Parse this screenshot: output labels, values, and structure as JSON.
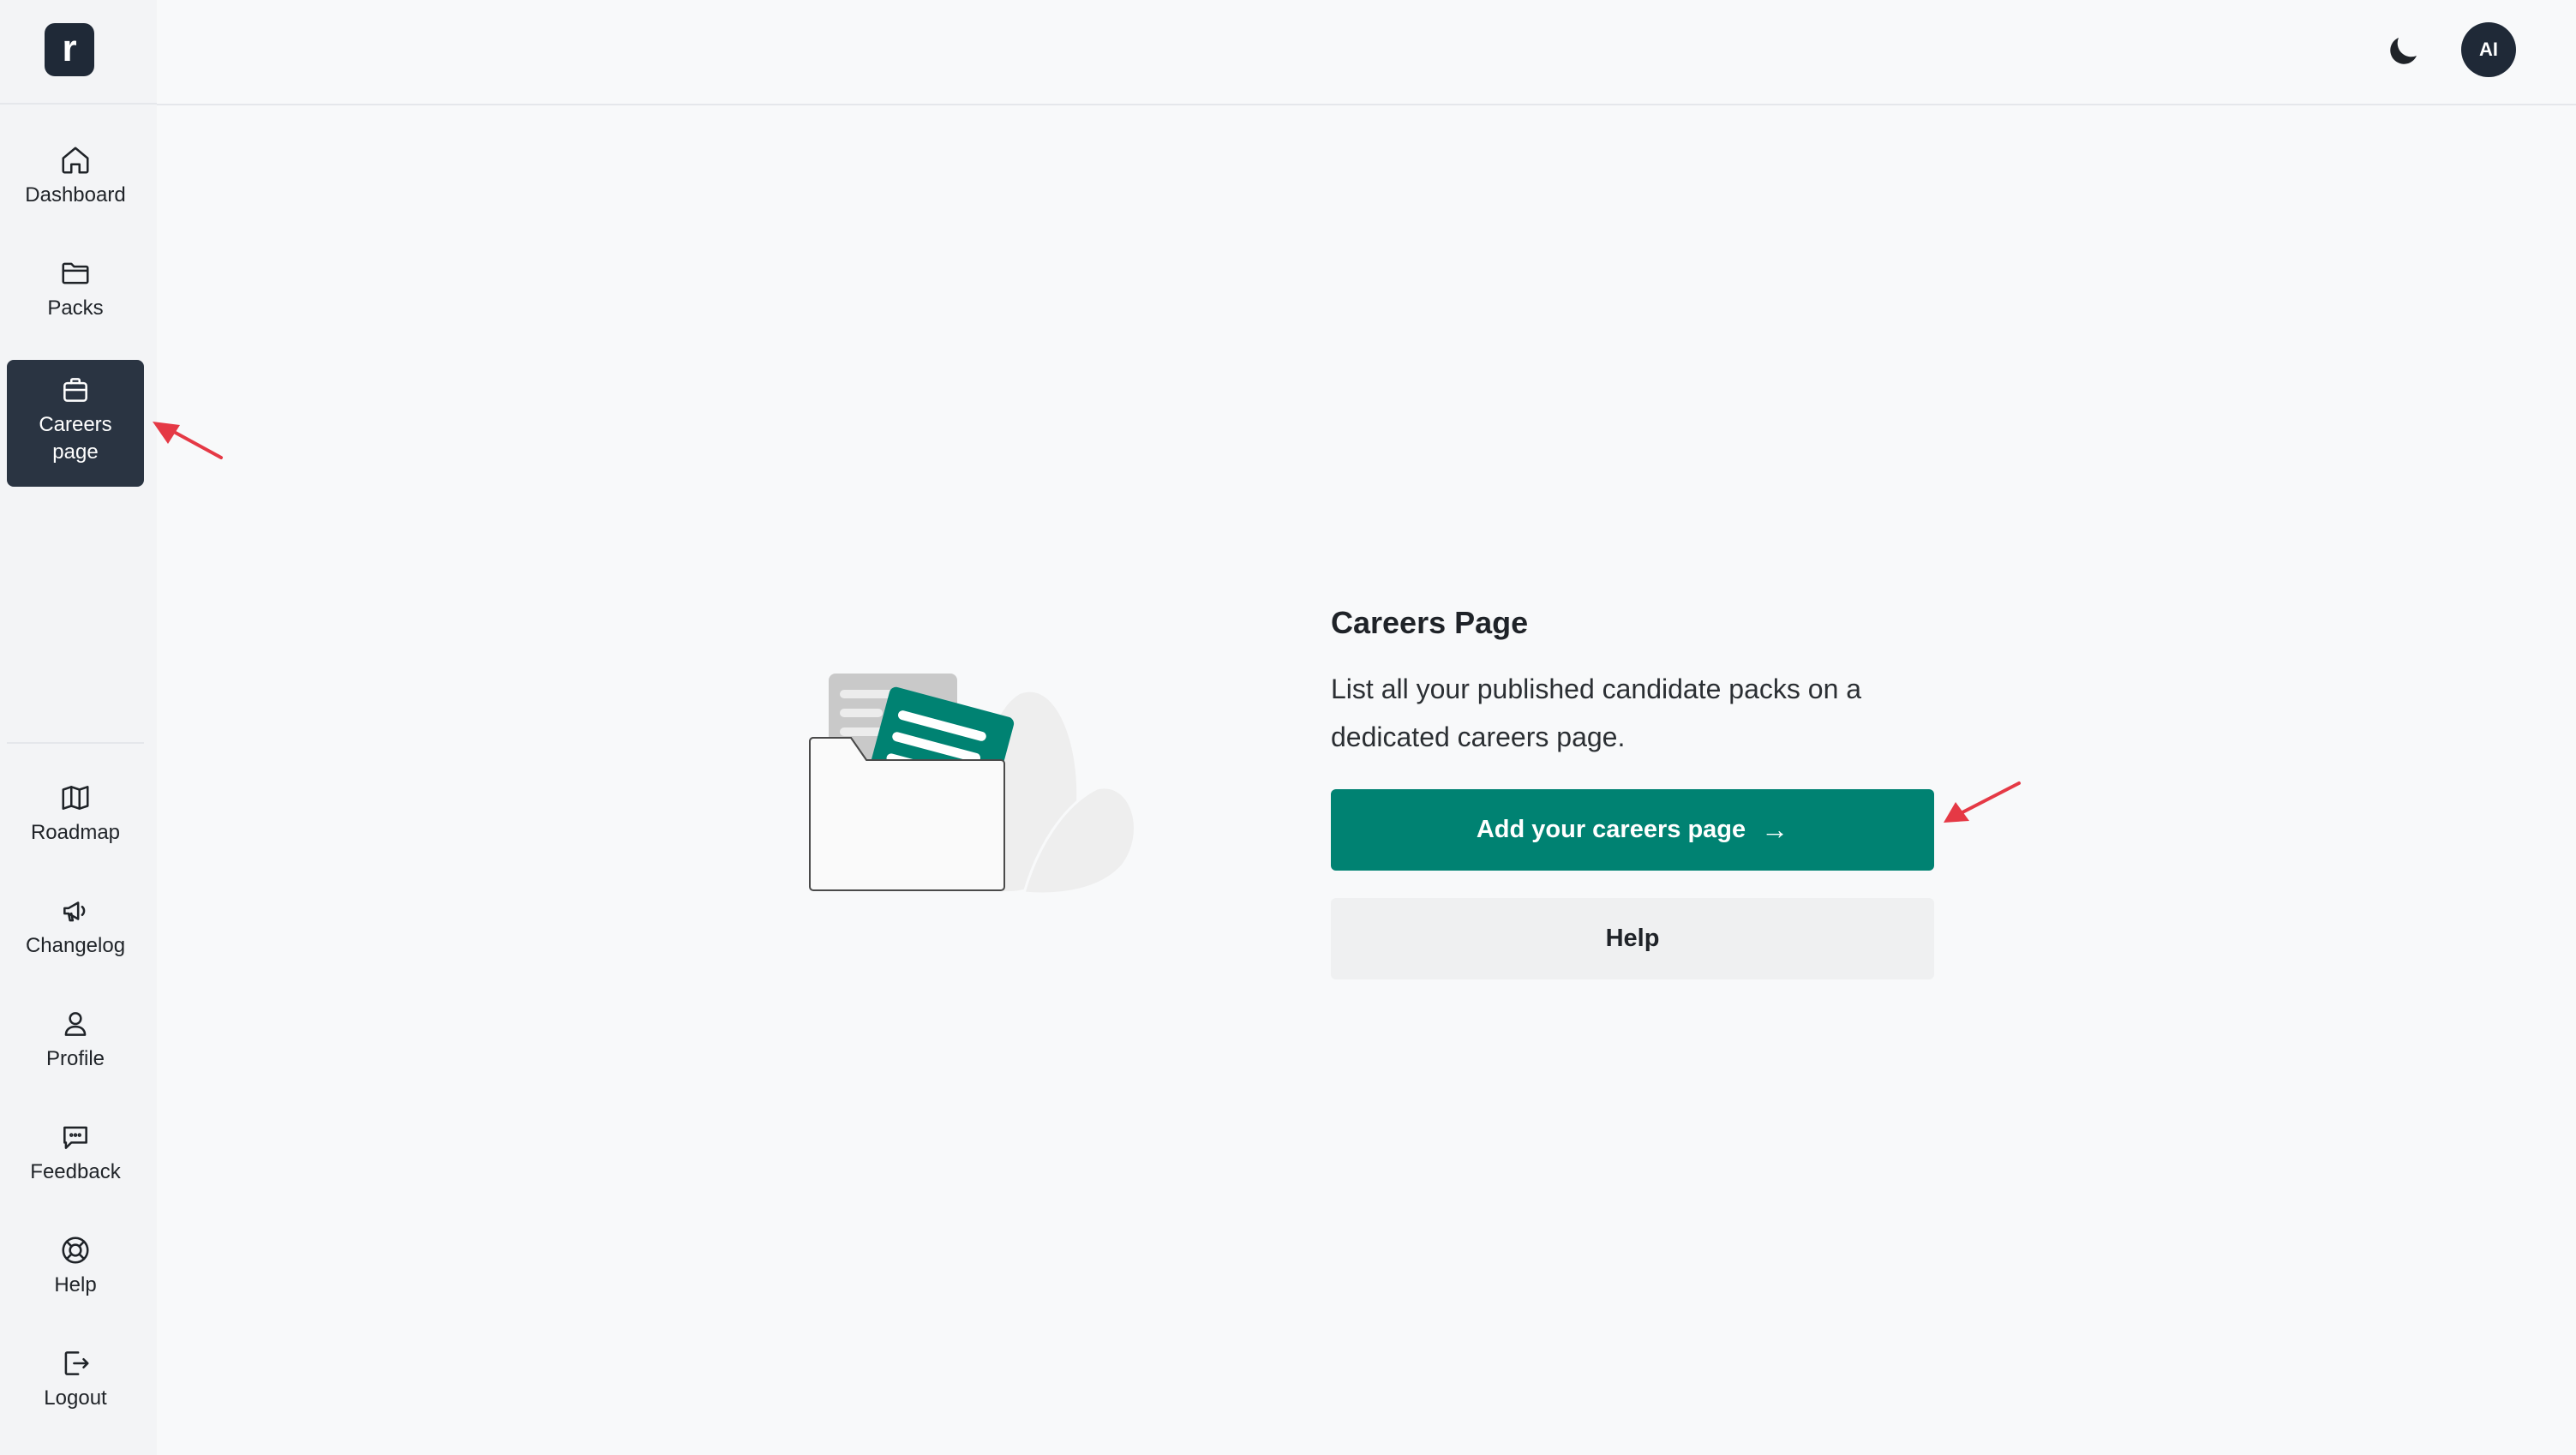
{
  "logo": {
    "letter": "r"
  },
  "sidebar": {
    "top_items": [
      {
        "label": "Dashboard",
        "icon": "home-icon"
      },
      {
        "label": "Packs",
        "icon": "folder-icon"
      },
      {
        "label": "Careers page",
        "icon": "briefcase-icon",
        "active": true
      }
    ],
    "bottom_items": [
      {
        "label": "Roadmap",
        "icon": "map-icon"
      },
      {
        "label": "Changelog",
        "icon": "megaphone-icon"
      },
      {
        "label": "Profile",
        "icon": "user-icon"
      },
      {
        "label": "Feedback",
        "icon": "message-icon"
      },
      {
        "label": "Help",
        "icon": "lifebuoy-icon"
      },
      {
        "label": "Logout",
        "icon": "logout-icon"
      }
    ]
  },
  "header": {
    "theme_toggle_icon": "moon-icon",
    "avatar_initials": "AI"
  },
  "main": {
    "title": "Careers Page",
    "description": "List all your published candidate packs on a dedicated careers page.",
    "primary_button": {
      "label": "Add your careers page",
      "arrow": "→"
    },
    "secondary_button": {
      "label": "Help"
    }
  },
  "colors": {
    "accent": "#008272",
    "sidebar_active": "#2a3442",
    "annotation_arrow": "#e53945"
  }
}
